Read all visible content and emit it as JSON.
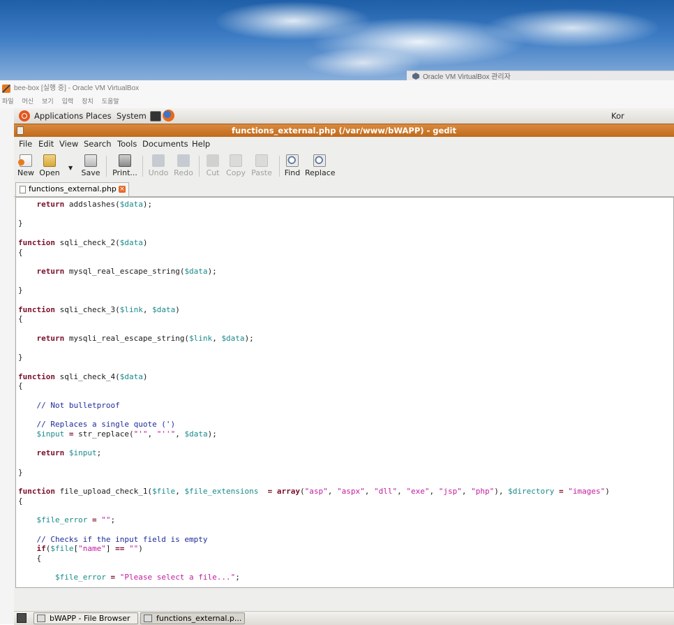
{
  "desktop": {
    "background_window_title": "Oracle VM VirtualBox 관리자"
  },
  "vbox": {
    "title": "bee-box [실행 중] - Oracle VM VirtualBox",
    "menu": [
      "파일",
      "머신",
      "보기",
      "입력",
      "장치",
      "도움말"
    ]
  },
  "top_panel": {
    "applications": "Applications",
    "places": "Places",
    "system": "System",
    "keyboard": "Kor"
  },
  "gedit": {
    "title": "functions_external.php (/var/www/bWAPP) - gedit",
    "menu": [
      "File",
      "Edit",
      "View",
      "Search",
      "Tools",
      "Documents",
      "Help"
    ],
    "toolbar": {
      "new": "New",
      "open": "Open",
      "save": "Save",
      "print": "Print...",
      "undo": "Undo",
      "redo": "Redo",
      "cut": "Cut",
      "copy": "Copy",
      "paste": "Paste",
      "find": "Find",
      "replace": "Replace"
    },
    "tab_label": "functions_external.php",
    "code_lines": [
      "    return addslashes($data);",
      "",
      "}",
      "",
      "function sqli_check_2($data)",
      "{",
      "",
      "    return mysql_real_escape_string($data);",
      "",
      "}",
      "",
      "function sqli_check_3($link, $data)",
      "{",
      "",
      "    return mysqli_real_escape_string($link, $data);",
      "",
      "}",
      "",
      "function sqli_check_4($data)",
      "{",
      "",
      "    // Not bulletproof",
      "",
      "    // Replaces a single quote (')",
      "    $input = str_replace(\"'\", \"''\", $data);",
      "",
      "    return $input;",
      "",
      "}",
      "",
      "function file_upload_check_1($file, $file_extensions  = array(\"asp\", \"aspx\", \"dll\", \"exe\", \"jsp\", \"php\"), $directory = \"images\")",
      "{",
      "",
      "    $file_error = \"\";",
      "",
      "    // Checks if the input field is empty",
      "    if($file[\"name\"] == \"\")",
      "    {",
      "",
      "        $file_error = \"Please select a file...\";"
    ]
  },
  "taskbar": {
    "items": [
      "bWAPP - File Browser",
      "functions_external.p..."
    ]
  }
}
